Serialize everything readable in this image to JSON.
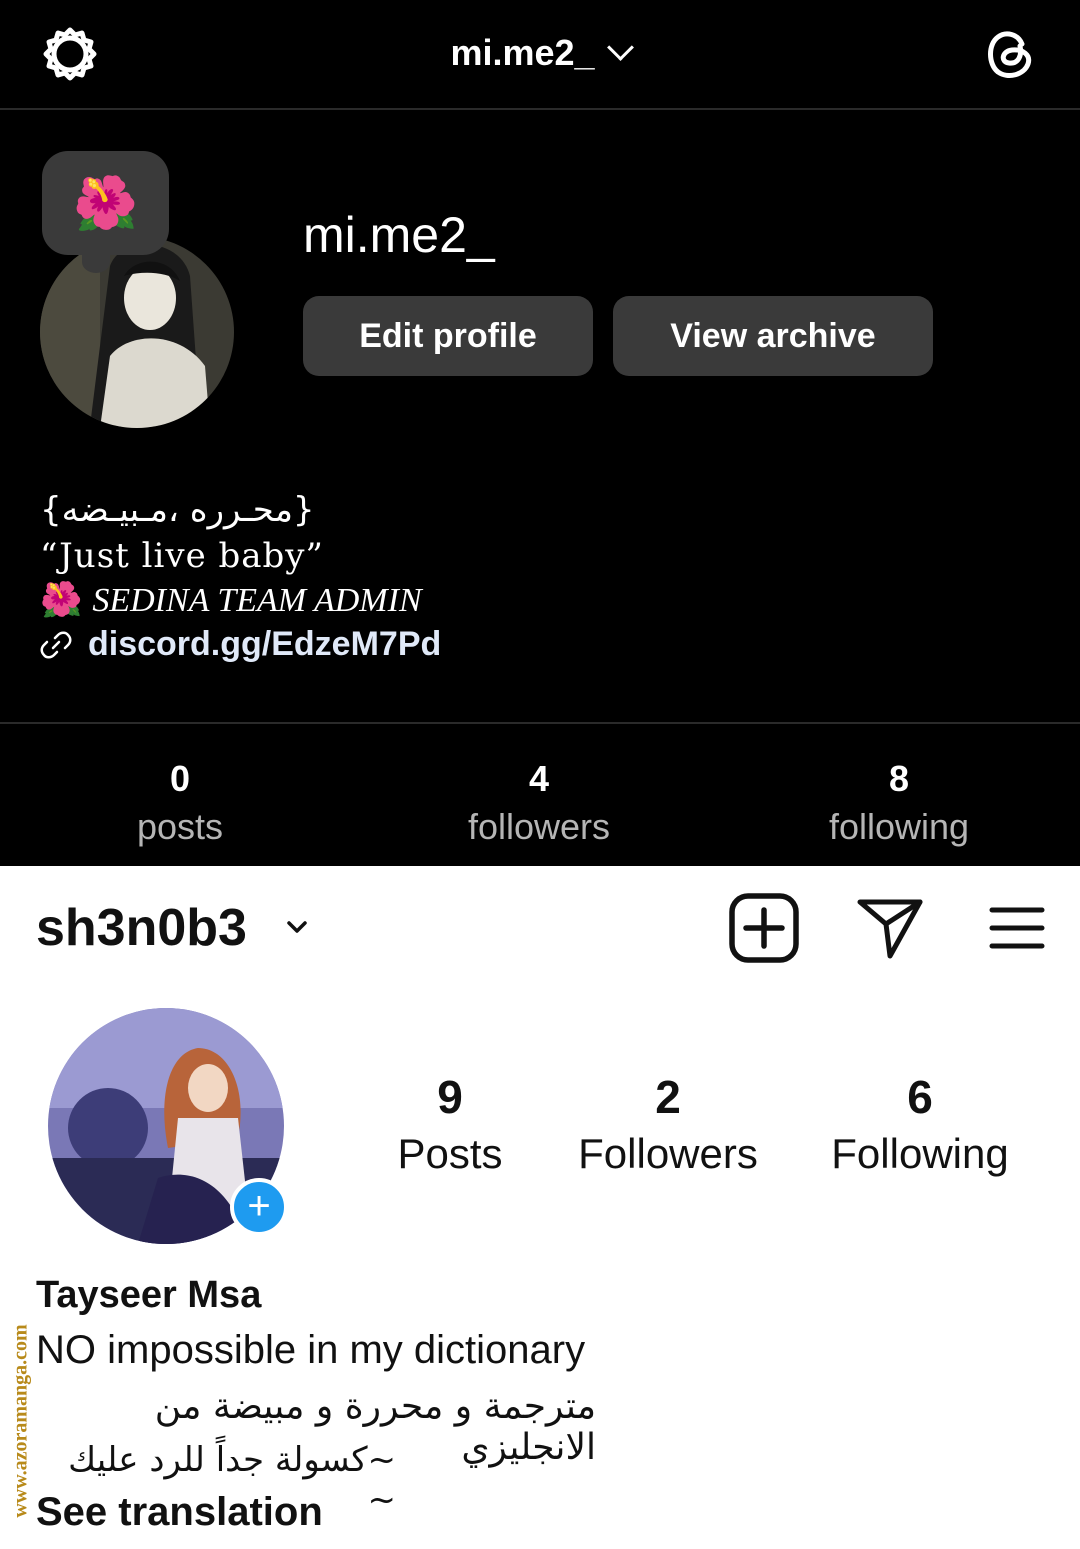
{
  "dark_profile": {
    "topbar": {
      "username": "mi.me2_"
    },
    "note": "🌺",
    "display_name": "mi.me2_",
    "buttons": {
      "edit": "Edit profile",
      "archive": "View archive"
    },
    "bio": {
      "line1": "{محـرره ،مـبيـضه}",
      "line2": "“Just live baby”",
      "line3_emoji": "🌺",
      "line3": "SEDINA TEAM ADMIN",
      "link": "discord.gg/EdzeM7Pd"
    },
    "stats": [
      {
        "value": "0",
        "label": "posts"
      },
      {
        "value": "4",
        "label": "followers"
      },
      {
        "value": "8",
        "label": "following"
      }
    ]
  },
  "light_profile": {
    "username": "sh3n0b3",
    "stats": [
      {
        "value": "9",
        "label": "Posts"
      },
      {
        "value": "2",
        "label": "Followers"
      },
      {
        "value": "6",
        "label": "Following"
      }
    ],
    "name": "Tayseer Msa",
    "bio1": "NO impossible in my dictionary",
    "bio2": "مترجمة و محررة و مبيضة من الانجليزي",
    "bio3": "~كسولة جداً للرد عليك ~",
    "see_translation": "See translation"
  },
  "watermark": "www.azoramanga.com",
  "colors": {
    "dark_bg": "#000000",
    "dark_button": "#3a3a3a",
    "light_bg": "#ffffff",
    "badge_blue": "#1e9bf0"
  }
}
